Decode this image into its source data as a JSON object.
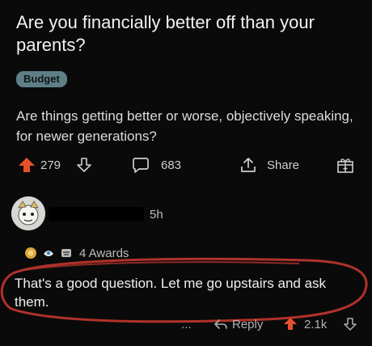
{
  "post": {
    "title": "Are you financially better off than your parents?",
    "flair": "Budget",
    "body": "Are things getting better or worse, objectively speaking, for newer generations?",
    "upvotes": "279",
    "comments": "683",
    "share_label": "Share"
  },
  "comment": {
    "time": "5h",
    "awards_label": "4 Awards",
    "text": "That's a good question. Let me go upstairs and ask them.",
    "more_label": "...",
    "reply_label": "Reply",
    "score": "2.1k"
  },
  "colors": {
    "upvote": "#e5502b",
    "flair_bg": "#5f7f86",
    "highlight": "#b0322a"
  }
}
